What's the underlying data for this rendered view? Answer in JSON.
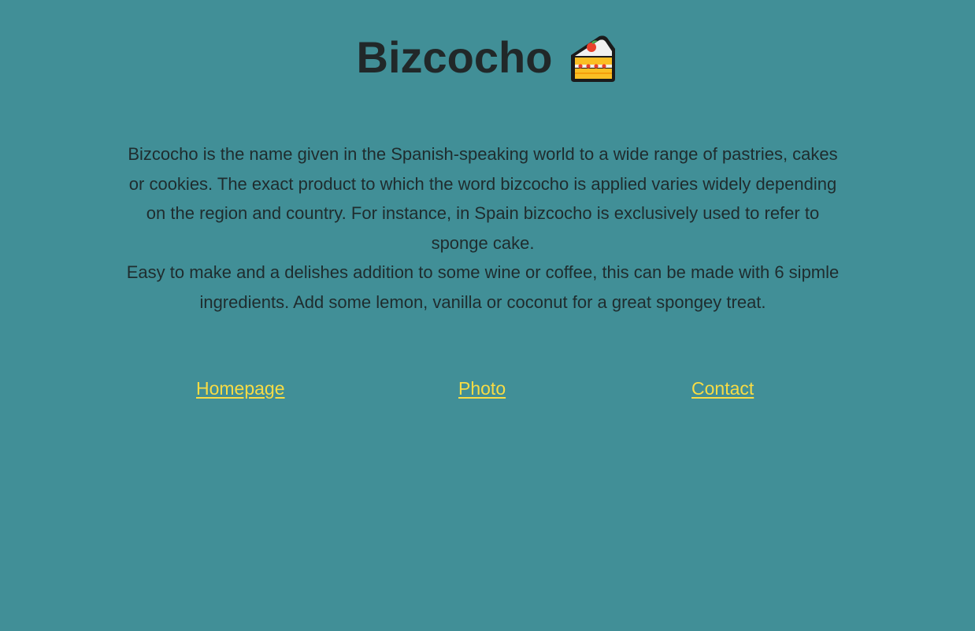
{
  "header": {
    "title": "Bizcocho",
    "icon": "shortcake-icon"
  },
  "intro": {
    "paragraph_1": "Bizcocho is the name given in the Spanish-speaking world to a wide range of pastries, cakes or cookies. The exact product to which the word bizcocho is applied varies widely depending on the region and country. For instance, in Spain bizcocho is exclusively used to refer to sponge cake.",
    "paragraph_2": "Easy to make and a delishes addition to some wine or coffee, this can be made with 6 sipmle ingredients. Add some lemon, vanilla or coconut for a great spongey treat."
  },
  "nav": {
    "homepage": "Homepage",
    "photo": "Photo",
    "contact": "Contact"
  },
  "colors": {
    "background": "#418F97",
    "link": "#F8DC44",
    "text": "#222829"
  }
}
